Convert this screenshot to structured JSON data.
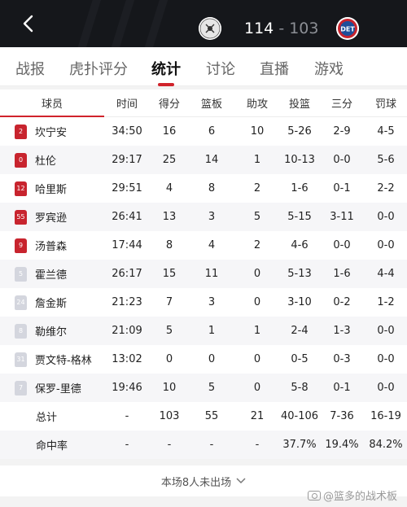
{
  "header": {
    "home_logo_text": "SPURS",
    "away_logo_text": "DET",
    "home_score": "114",
    "separator": "-",
    "away_score": "103"
  },
  "tabs": [
    {
      "label": "战报"
    },
    {
      "label": "虎扑评分"
    },
    {
      "label": "统计"
    },
    {
      "label": "讨论"
    },
    {
      "label": "直播"
    },
    {
      "label": "游戏"
    }
  ],
  "active_tab": "统计",
  "columns": [
    "球员",
    "时间",
    "得分",
    "篮板",
    "助攻",
    "投篮",
    "三分",
    "罚球"
  ],
  "players": [
    {
      "number": "2",
      "name": "坎宁安",
      "starter": true,
      "min": "34:50",
      "pts": "16",
      "reb": "6",
      "ast": "10",
      "fg": "5-26",
      "tp": "2-9",
      "ft": "4-5"
    },
    {
      "number": "0",
      "name": "杜伦",
      "starter": true,
      "min": "29:17",
      "pts": "25",
      "reb": "14",
      "ast": "1",
      "fg": "10-13",
      "tp": "0-0",
      "ft": "5-6"
    },
    {
      "number": "12",
      "name": "哈里斯",
      "starter": true,
      "min": "29:51",
      "pts": "4",
      "reb": "8",
      "ast": "2",
      "fg": "1-6",
      "tp": "0-1",
      "ft": "2-2"
    },
    {
      "number": "55",
      "name": "罗宾逊",
      "starter": true,
      "min": "26:41",
      "pts": "13",
      "reb": "3",
      "ast": "5",
      "fg": "5-15",
      "tp": "3-11",
      "ft": "0-0"
    },
    {
      "number": "9",
      "name": "汤普森",
      "starter": true,
      "min": "17:44",
      "pts": "8",
      "reb": "4",
      "ast": "2",
      "fg": "4-6",
      "tp": "0-0",
      "ft": "0-0"
    },
    {
      "number": "5",
      "name": "霍兰德",
      "starter": false,
      "min": "26:17",
      "pts": "15",
      "reb": "11",
      "ast": "0",
      "fg": "5-13",
      "tp": "1-6",
      "ft": "4-4"
    },
    {
      "number": "24",
      "name": "詹金斯",
      "starter": false,
      "min": "21:23",
      "pts": "7",
      "reb": "3",
      "ast": "0",
      "fg": "3-10",
      "tp": "0-2",
      "ft": "1-2"
    },
    {
      "number": "8",
      "name": "勒维尔",
      "starter": false,
      "min": "21:09",
      "pts": "5",
      "reb": "1",
      "ast": "1",
      "fg": "2-4",
      "tp": "1-3",
      "ft": "0-0"
    },
    {
      "number": "31",
      "name": "贾文特-格林",
      "starter": false,
      "min": "13:02",
      "pts": "0",
      "reb": "0",
      "ast": "0",
      "fg": "0-5",
      "tp": "0-3",
      "ft": "0-0"
    },
    {
      "number": "7",
      "name": "保罗-里德",
      "starter": false,
      "min": "19:46",
      "pts": "10",
      "reb": "5",
      "ast": "0",
      "fg": "5-8",
      "tp": "0-1",
      "ft": "0-0"
    }
  ],
  "totals": {
    "label": "总计",
    "min": "-",
    "pts": "103",
    "reb": "55",
    "ast": "21",
    "fg": "40-106",
    "tp": "7-36",
    "ft": "16-19"
  },
  "percentages": {
    "label": "命中率",
    "min": "-",
    "pts": "-",
    "reb": "-",
    "ast": "-",
    "fg": "37.7%",
    "tp": "19.4%",
    "ft": "84.2%"
  },
  "footer_note": "本场8人未出场",
  "watermark": "@篮多的战术板",
  "colors": {
    "accent": "#d0232b",
    "header_bg": "#15171b",
    "starter_jersey": "#c8242e",
    "bench_jersey": "#d4d6de"
  }
}
